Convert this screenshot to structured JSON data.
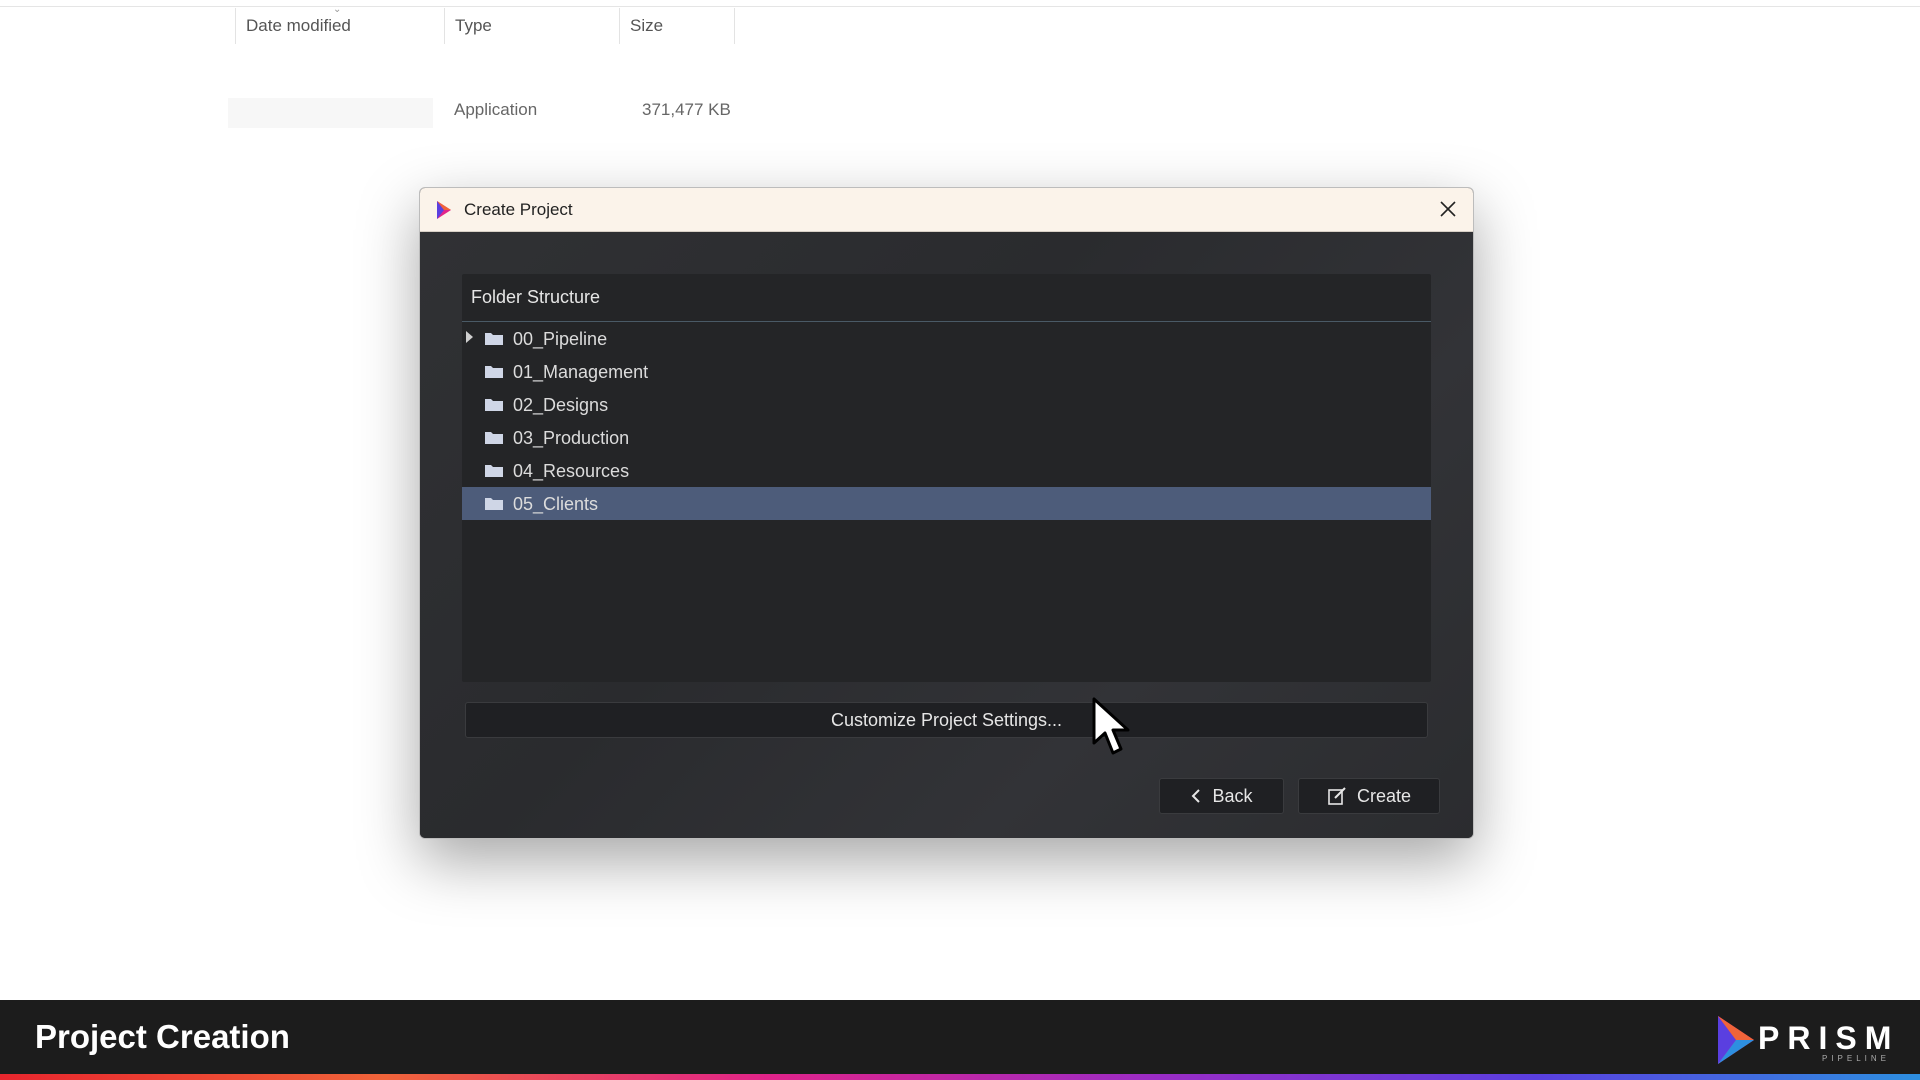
{
  "explorer": {
    "columns": [
      "Date modified",
      "Type",
      "Size"
    ],
    "file": {
      "type": "Application",
      "size": "371,477 KB"
    }
  },
  "dialog": {
    "title": "Create Project",
    "tree": {
      "header": "Folder Structure",
      "items": [
        {
          "label": "00_Pipeline",
          "expandable": true,
          "selected": false
        },
        {
          "label": "01_Management",
          "expandable": false,
          "selected": false
        },
        {
          "label": "02_Designs",
          "expandable": false,
          "selected": false
        },
        {
          "label": "03_Production",
          "expandable": false,
          "selected": false
        },
        {
          "label": "04_Resources",
          "expandable": false,
          "selected": false
        },
        {
          "label": "05_Clients",
          "expandable": false,
          "selected": true
        }
      ]
    },
    "customize_label": "Customize Project Settings...",
    "back_label": "Back",
    "create_label": "Create"
  },
  "banner": {
    "title": "Project Creation",
    "brand": "PRISM",
    "brand_sub": "PIPELINE"
  },
  "colors": {
    "selection": "#4d5c7a",
    "folder": "#cfd6e6",
    "accent_gradient": [
      "#e8262e",
      "#e1248a",
      "#5a3fe0",
      "#2d8fe0"
    ]
  }
}
